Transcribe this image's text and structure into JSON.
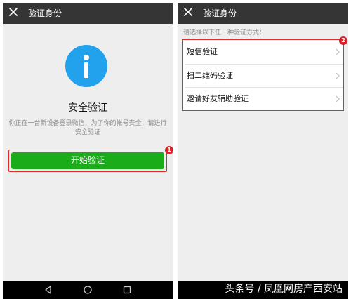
{
  "left_screen": {
    "header": {
      "title": "验证身份",
      "close_icon": "close-icon"
    },
    "info_icon": "info-icon",
    "security_title": "安全验证",
    "description": "你正在一台新设备登录微信，为了你的帐号安全，请进行安全验证",
    "start_button": "开始验证",
    "badge": "1",
    "nav_icons": [
      "back-triangle-icon",
      "home-circle-icon",
      "recent-square-icon"
    ]
  },
  "right_screen": {
    "header": {
      "title": "验证身份",
      "close_icon": "close-icon"
    },
    "hint": "请选择以下任一种验证方式：",
    "options": [
      {
        "label": "短信验证"
      },
      {
        "label": "扫二维码验证"
      },
      {
        "label": "邀请好友辅助验证"
      }
    ],
    "badge": "2"
  },
  "watermark": "头条号 / 凤凰网房产西安站",
  "colors": {
    "header": "#353535",
    "accent_blue": "#22a2ec",
    "button_green": "#1aad19",
    "highlight_red": "#e32b2b",
    "background": "#eeeeee"
  }
}
